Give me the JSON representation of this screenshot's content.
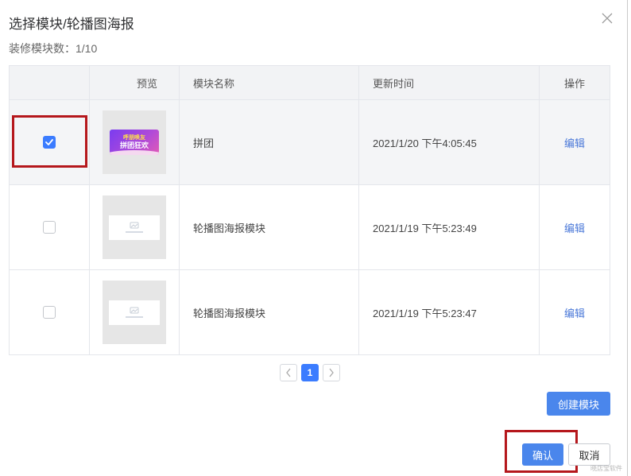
{
  "dialog": {
    "title": "选择模块/轮播图海报",
    "subtitle": "装修模块数：1/10"
  },
  "table": {
    "headers": [
      "",
      "预览",
      "模块名称",
      "更新时间",
      "操作"
    ],
    "rows": [
      {
        "checked": true,
        "preview": {
          "type": "banner",
          "line1": "呼朋唤友",
          "line2": "拼团狂欢"
        },
        "name": "拼团",
        "updated": "2021/1/20 下午4:05:45",
        "action": "编辑"
      },
      {
        "checked": false,
        "preview": {
          "type": "placeholder"
        },
        "name": "轮播图海报模块",
        "updated": "2021/1/19 下午5:23:49",
        "action": "编辑"
      },
      {
        "checked": false,
        "preview": {
          "type": "placeholder"
        },
        "name": "轮播图海报模块",
        "updated": "2021/1/19 下午5:23:47",
        "action": "编辑"
      }
    ]
  },
  "pagination": {
    "current": "1"
  },
  "buttons": {
    "create": "创建模块",
    "confirm": "确认",
    "cancel": "取消"
  },
  "watermark": "晓店宝软件",
  "colors": {
    "primary": "#3b7cff",
    "button": "#4a86ec",
    "link": "#4a78d8",
    "annotation": "#b5171c"
  }
}
